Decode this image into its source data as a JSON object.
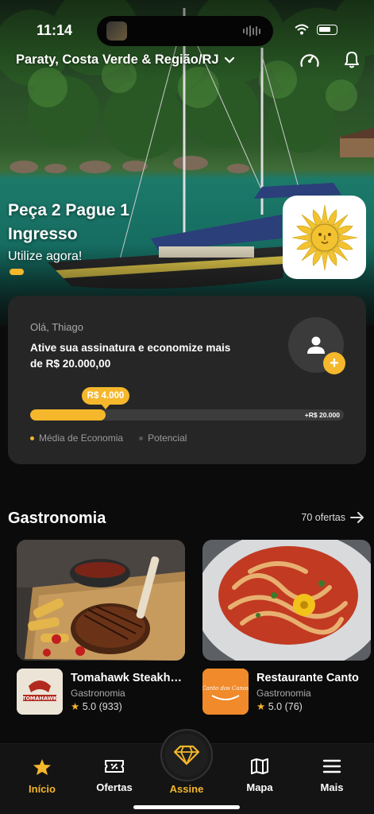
{
  "status_bar": {
    "time": "11:14"
  },
  "header": {
    "location": "Paraty, Costa Verde & Região/RJ"
  },
  "promo": {
    "title": "Peça 2 Pague 1 Ingresso",
    "subtitle": "Utilize agora!"
  },
  "savings": {
    "greeting": "Olá, Thiago",
    "cta": "Ative sua assinatura e economize mais de  R$ 20.000,00",
    "progress_label": "R$ 4.000",
    "progress_max_label": "+R$ 20.000",
    "progress_fraction": 0.24,
    "legend_average": "Média de Economia",
    "legend_potential": "Potencial"
  },
  "section": {
    "title": "Gastronomia",
    "link": "70 ofertas"
  },
  "offers": [
    {
      "name": "Tomahawk Steakhouse",
      "category": "Gastronomia",
      "rating": "5.0",
      "reviews": "(933)",
      "logo_text": "TOMAHAWK"
    },
    {
      "name": "Restaurante Canto",
      "category": "Gastronomia",
      "rating": "5.0",
      "reviews": "(76)",
      "logo_text": "Canto dos Canos"
    }
  ],
  "nav": {
    "home": "Início",
    "offers": "Ofertas",
    "subscribe": "Assine",
    "map": "Mapa",
    "more": "Mais"
  },
  "colors": {
    "accent": "#f5b72b",
    "card": "#262626",
    "background": "#0b0b0b"
  }
}
